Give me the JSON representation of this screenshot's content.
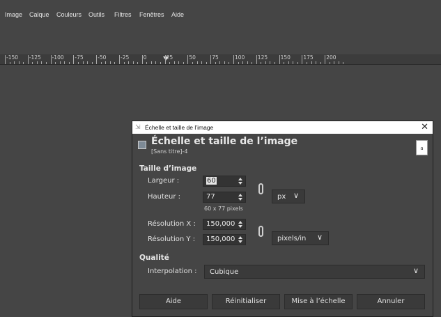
{
  "menu": {
    "items": [
      "Image",
      "Calque",
      "Couleurs",
      "Outils",
      "Filtres",
      "Fenêtres",
      "Aide"
    ]
  },
  "ruler": {
    "labels": [
      "-150",
      "-125",
      "-100",
      "-75",
      "-50",
      "-25",
      "0",
      "25",
      "50",
      "75",
      "100",
      "125",
      "150",
      "175",
      "200"
    ]
  },
  "dialog": {
    "window_title": "Échelle et taille de l’image",
    "close_glyph": "✕",
    "header_title": "Échelle et taille de l’image",
    "header_subtitle": "[Sans titre]-4",
    "thumb_glyph": "a",
    "image_size": {
      "section_title": "Taille d’image",
      "width_label": "Largeur :",
      "width_value": "60",
      "height_label": "Hauteur :",
      "height_value": "77",
      "unit": "px",
      "pixels_note": "60 x 77 pixels",
      "res_x_label": "Résolution X :",
      "res_x_value": "150,000",
      "res_y_label": "Résolution Y :",
      "res_y_value": "150,000",
      "res_unit": "pixels/in"
    },
    "quality": {
      "section_title": "Qualité",
      "interpolation_label": "Interpolation :",
      "interpolation_value": "Cubique"
    },
    "buttons": {
      "help": "Aide",
      "reset": "Réinitialiser",
      "scale": "Mise à l’échelle",
      "cancel": "Annuler"
    },
    "chevron": "∨"
  }
}
